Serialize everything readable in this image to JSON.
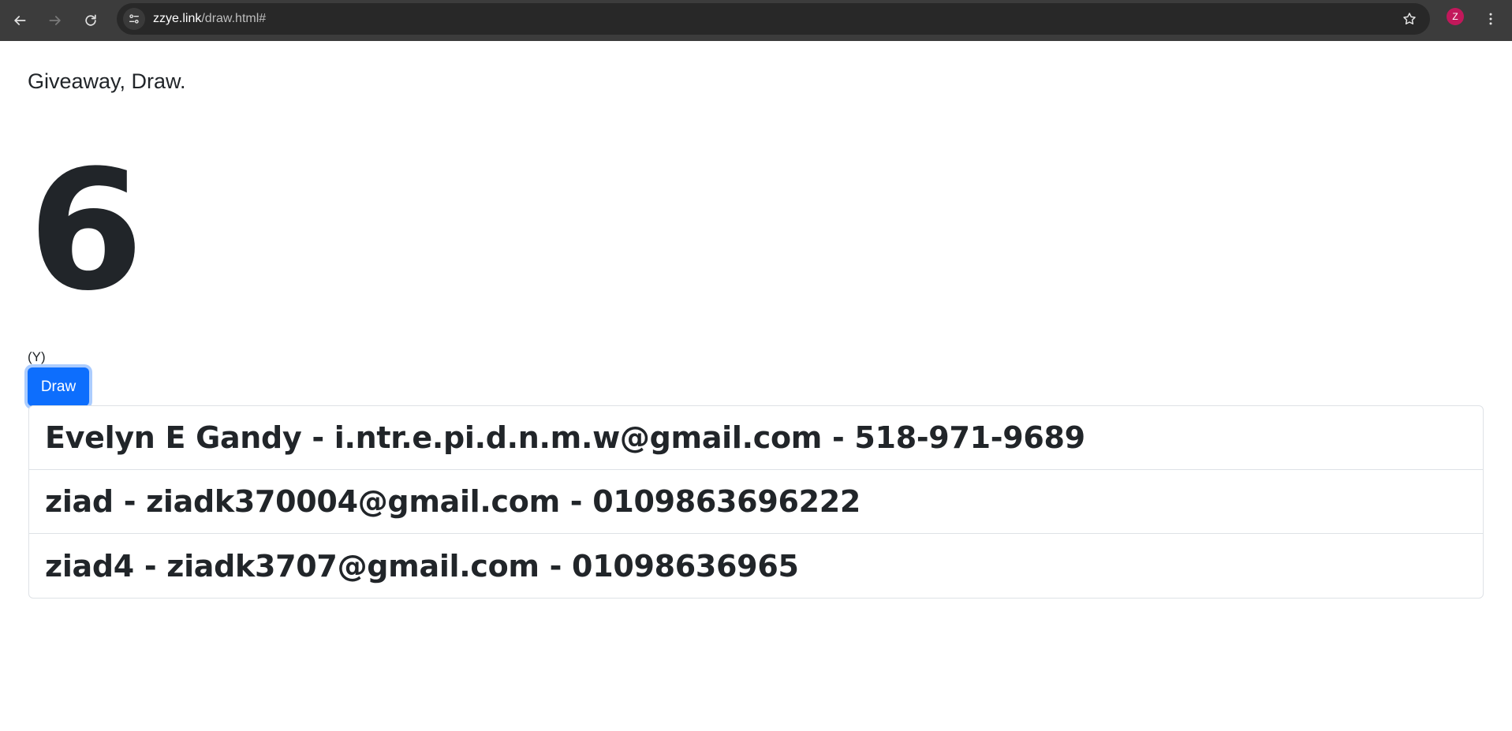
{
  "browser": {
    "url_host": "zzye.link",
    "url_path": "/draw.html#",
    "profile_initial": "Z",
    "profile_color": "#c2185b",
    "icons": [
      "back-arrow-icon",
      "forward-arrow-icon",
      "reload-icon",
      "site-info-icon",
      "bookmark-star-icon",
      "kebab-menu-icon"
    ]
  },
  "page": {
    "heading": "Giveaway, Draw.",
    "count": "6",
    "note": "(Y)",
    "draw_label": "Draw",
    "accent_color": "#0d6efd"
  },
  "entries": [
    {
      "text": "Evelyn E Gandy - i.ntr.e.pi.d.n.m.w@gmail.com - 518-971-9689"
    },
    {
      "text": "ziad - ziadk370004@gmail.com - 0109863696222"
    },
    {
      "text": "ziad4 - ziadk3707@gmail.com - 01098636965"
    }
  ]
}
